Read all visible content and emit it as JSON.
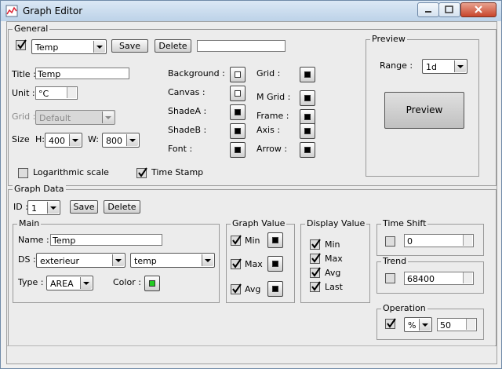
{
  "window": {
    "title": "Graph Editor"
  },
  "general": {
    "legend": "General",
    "graph_enabled": true,
    "graph_select": "Temp",
    "save_label": "Save",
    "delete_label": "Delete",
    "name_field_value": "",
    "title_label": "Title :",
    "title_value": "Temp",
    "unit_label": "Unit :",
    "unit_value": "°C",
    "grid_label": "Grid :",
    "grid_value": "Default",
    "size_label": "Size",
    "h_label": "H:",
    "h_value": "400",
    "w_label": "W:",
    "w_value": "800",
    "colors": [
      {
        "label": "Background :",
        "filled": false
      },
      {
        "label": "Canvas :",
        "filled": false
      },
      {
        "label": "ShadeA :",
        "filled": true
      },
      {
        "label": "ShadeB :",
        "filled": true
      },
      {
        "label": "Font :",
        "filled": true
      }
    ],
    "colors2": [
      {
        "label": "Grid :",
        "filled": true
      },
      {
        "label": "M Grid :",
        "filled": true
      },
      {
        "label": "Frame :",
        "filled": true
      },
      {
        "label": "Axis :",
        "filled": true
      },
      {
        "label": "Arrow :",
        "filled": true
      }
    ],
    "log_scale_label": "Logarithmic scale",
    "log_scale_checked": false,
    "timestamp_label": "Time Stamp",
    "timestamp_checked": true
  },
  "preview": {
    "legend": "Preview",
    "range_label": "Range :",
    "range_value": "1d",
    "button_label": "Preview"
  },
  "graph_data": {
    "legend": "Graph Data",
    "id_label": "ID :",
    "id_value": "1",
    "save_label": "Save",
    "delete_label": "Delete",
    "main": {
      "legend": "Main",
      "name_label": "Name :",
      "name_value": "Temp",
      "ds_label": "DS :",
      "ds_value": "exterieur",
      "ds_field": "temp",
      "type_label": "Type :",
      "type_value": "AREA",
      "color_label": "Color :",
      "color_value": "#22cc22"
    },
    "graph_value": {
      "legend": "Graph Value",
      "items": [
        {
          "label": "Min",
          "checked": true
        },
        {
          "label": "Max",
          "checked": true
        },
        {
          "label": "Avg",
          "checked": true
        }
      ]
    },
    "display_value": {
      "legend": "Display Value",
      "items": [
        {
          "label": "Min",
          "checked": true
        },
        {
          "label": "Max",
          "checked": true
        },
        {
          "label": "Avg",
          "checked": true
        },
        {
          "label": "Last",
          "checked": true
        }
      ]
    },
    "time_shift": {
      "legend": "Time Shift",
      "checked": false,
      "value": "0"
    },
    "trend": {
      "legend": "Trend",
      "checked": false,
      "value": "68400"
    },
    "operation": {
      "legend": "Operation",
      "checked": true,
      "op": "%",
      "value": "50"
    }
  }
}
